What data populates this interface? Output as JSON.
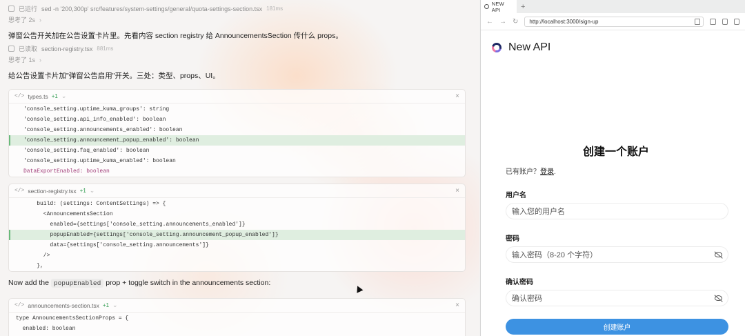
{
  "chat": {
    "run1": {
      "label": "已运行",
      "command": "sed -n '200,300p' src/features/system-settings/general/quota-settings-section.tsx",
      "duration": "181ms"
    },
    "think1": "思考了 2s",
    "msg1": "弹窗公告开关加在公告设置卡片里。先看内容 section registry 给 AnnouncementsSection 传什么 props。",
    "read1": {
      "label": "已读取",
      "file": "section-registry.tsx",
      "duration": "881ms"
    },
    "think2": "思考了 1s",
    "msg2": "给公告设置卡片加\"弹窗公告启用\"开关。三处：类型、props、UI。",
    "msg3_pre": "Now add the ",
    "msg3_code": "popupEnabled",
    "msg3_post": " prop + toggle switch in the announcements section:",
    "cards": [
      {
        "tag": "</>",
        "file": "types.ts",
        "diff": "+1",
        "lines": [
          "'console_setting.uptime_kuma_groups': string",
          "'console_setting.api_info_enabled': boolean",
          "'console_setting.announcements_enabled': boolean",
          "'console_setting.announcement_popup_enabled': boolean",
          "'console_setting.faq_enabled': boolean",
          "'console_setting.uptime_kuma_enabled': boolean",
          "DataExportEnabled: boolean"
        ]
      },
      {
        "tag": "</>",
        "file": "section-registry.tsx",
        "diff": "+1",
        "lines": [
          "    build: (settings: ContentSettings) => {",
          "      <AnnouncementsSection",
          "        enabled={settings['console_setting.announcements_enabled']}",
          "        popupEnabled={settings['console_setting.announcement_popup_enabled']}",
          "        data={settings['console_setting.announcements']}",
          "      />",
          "    },"
        ]
      },
      {
        "tag": "</>",
        "file": "announcements-section.tsx",
        "diff": "+1",
        "lines": [
          "type AnnouncementsSectionProps = {",
          "  enabled: boolean"
        ]
      }
    ]
  },
  "browser": {
    "tab_title": "NEW API",
    "new_tab": "+",
    "url": "http://localhost:3000/sign-up",
    "brand": "New API",
    "form": {
      "title": "创建一个账户",
      "have_account": "已有账户？",
      "login_link": "登录",
      "login_suffix": ".",
      "username_label": "用户名",
      "username_placeholder": "输入您的用户名",
      "password_label": "密码",
      "password_placeholder": "输入密码（8-20 个字符）",
      "confirm_label": "确认密码",
      "confirm_placeholder": "确认密码",
      "submit": "创建账户"
    }
  },
  "colors": {
    "accent": "#3d92e2",
    "diff_highlight": "#dfeee0"
  }
}
